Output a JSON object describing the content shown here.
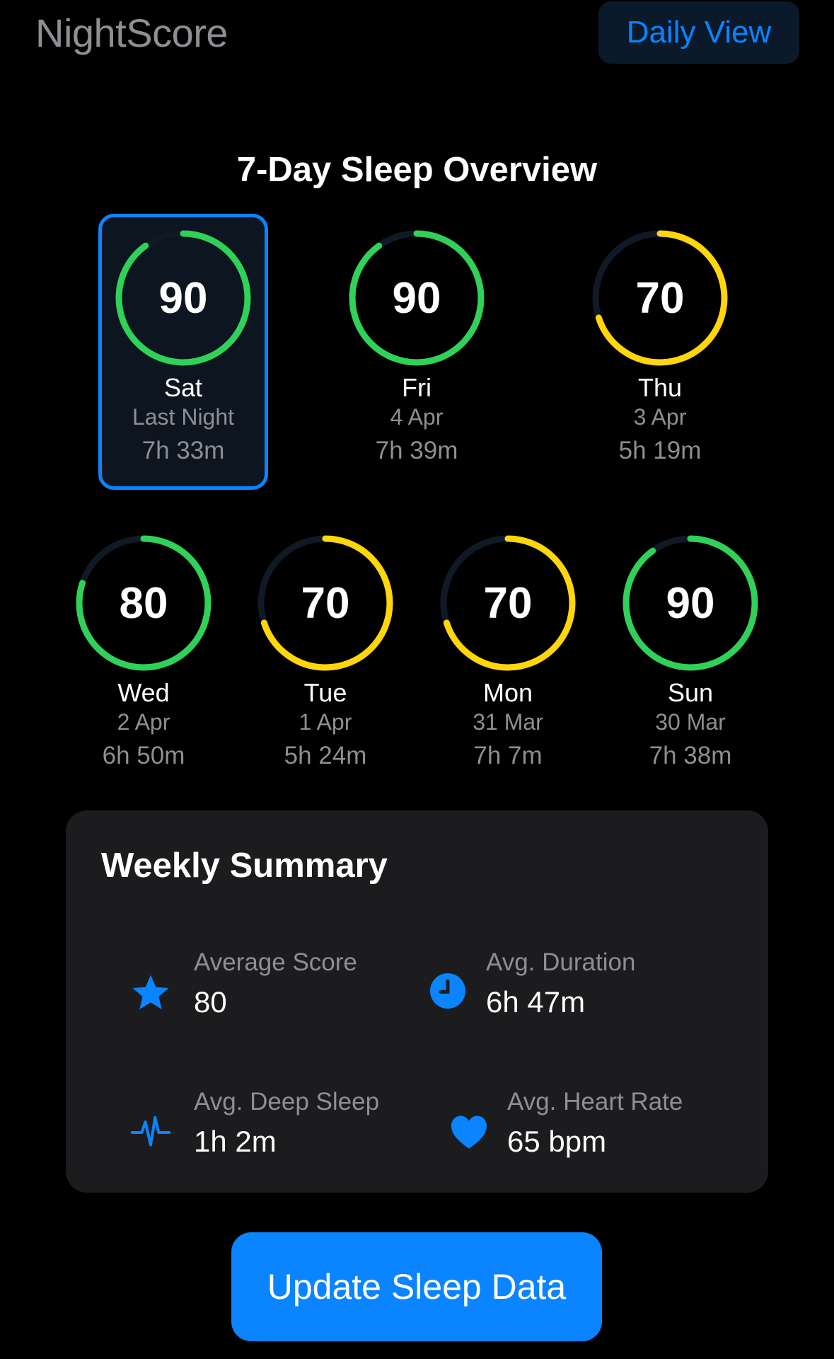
{
  "header": {
    "app_title": "NightScore",
    "daily_view_label": "Daily View"
  },
  "overview": {
    "title": "7-Day Sleep Overview",
    "days": [
      {
        "day": "Sat",
        "date": "Last Night",
        "duration": "7h 33m",
        "score": 90,
        "score_text": "90",
        "ring_color": "#30d158",
        "selected": true
      },
      {
        "day": "Fri",
        "date": "4 Apr",
        "duration": "7h 39m",
        "score": 90,
        "score_text": "90",
        "ring_color": "#30d158",
        "selected": false
      },
      {
        "day": "Thu",
        "date": "3 Apr",
        "duration": "5h 19m",
        "score": 70,
        "score_text": "70",
        "ring_color": "#ffd60a",
        "selected": false
      },
      {
        "day": "Wed",
        "date": "2 Apr",
        "duration": "6h 50m",
        "score": 80,
        "score_text": "80",
        "ring_color": "#30d158",
        "selected": false
      },
      {
        "day": "Tue",
        "date": "1 Apr",
        "duration": "5h 24m",
        "score": 70,
        "score_text": "70",
        "ring_color": "#ffd60a",
        "selected": false
      },
      {
        "day": "Mon",
        "date": "31 Mar",
        "duration": "7h 7m",
        "score": 70,
        "score_text": "70",
        "ring_color": "#ffd60a",
        "selected": false
      },
      {
        "day": "Sun",
        "date": "30 Mar",
        "duration": "7h 38m",
        "score": 90,
        "score_text": "90",
        "ring_color": "#30d158",
        "selected": false
      }
    ]
  },
  "summary": {
    "title": "Weekly Summary",
    "stats": [
      {
        "label": "Average Score",
        "value": "80",
        "icon": "star-icon"
      },
      {
        "label": "Avg. Duration",
        "value": "6h 47m",
        "icon": "clock-icon"
      },
      {
        "label": "Avg. Deep Sleep",
        "value": "1h 2m",
        "icon": "waveform-icon"
      },
      {
        "label": "Avg. Heart Rate",
        "value": "65 bpm",
        "icon": "heart-icon"
      }
    ]
  },
  "actions": {
    "update_label": "Update Sleep Data"
  },
  "colors": {
    "accent": "#0a84ff",
    "good": "#30d158",
    "fair": "#ffd60a",
    "ring_track": "#101a26"
  }
}
